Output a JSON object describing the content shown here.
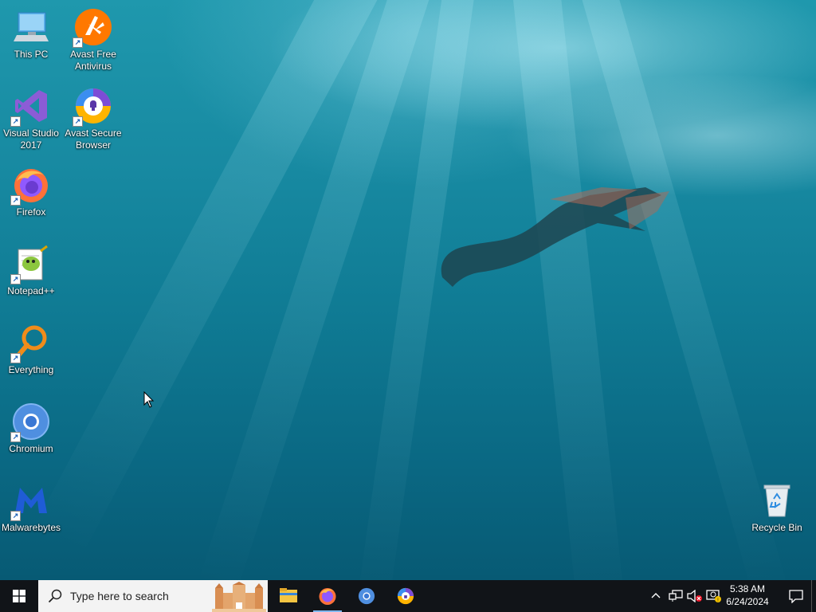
{
  "desktop": {
    "icons": [
      {
        "label": "This PC",
        "icon": "this-pc-icon"
      },
      {
        "label": "Avast Free Antivirus",
        "icon": "avast-antivirus-icon"
      },
      {
        "label": "Visual Studio 2017",
        "icon": "visual-studio-icon"
      },
      {
        "label": "Avast Secure Browser",
        "icon": "avast-browser-icon"
      },
      {
        "label": "Firefox",
        "icon": "firefox-icon"
      },
      {
        "label": "Notepad++",
        "icon": "notepadpp-icon"
      },
      {
        "label": "Everything",
        "icon": "everything-icon"
      },
      {
        "label": "Chromium",
        "icon": "chromium-icon"
      },
      {
        "label": "Malwarebytes",
        "icon": "malwarebytes-icon"
      },
      {
        "label": "Recycle Bin",
        "icon": "recycle-bin-icon"
      }
    ]
  },
  "taskbar": {
    "search_placeholder": "Type here to search",
    "apps": [
      "File Explorer",
      "Firefox",
      "Chromium",
      "Avast Secure Browser"
    ],
    "clock_time": "5:38 AM",
    "clock_date": "6/24/2024"
  },
  "colors": {
    "taskbar": "#111418",
    "accent": "#7fb8f0"
  }
}
